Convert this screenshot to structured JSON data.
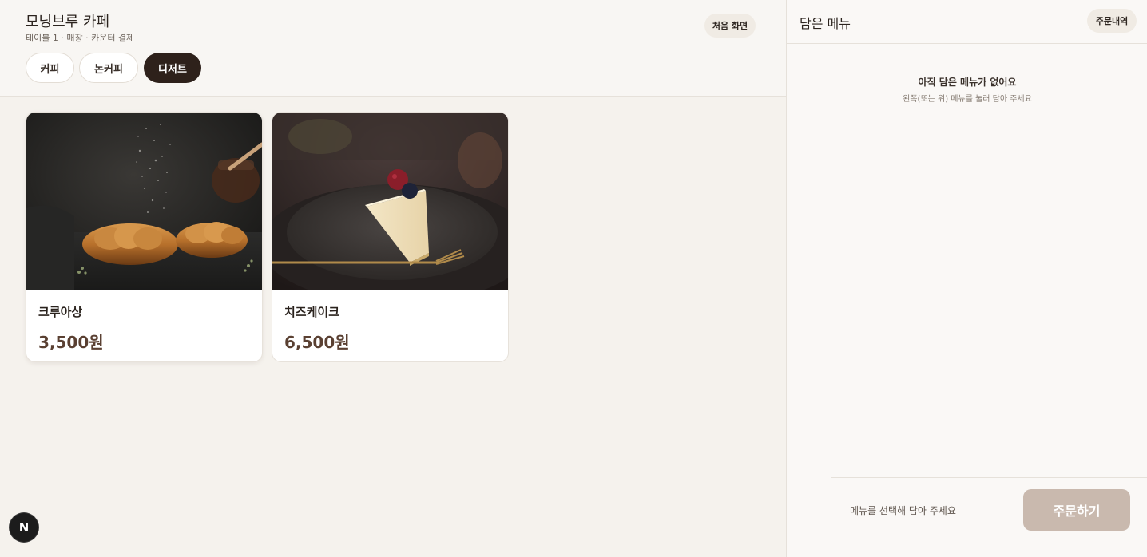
{
  "header": {
    "store_name": "모닝브루 카페",
    "store_info": "테이블 1 · 매장 · 카운터 결제",
    "home_button": "처음 화면"
  },
  "tabs": [
    {
      "label": "커피",
      "active": false
    },
    {
      "label": "논커피",
      "active": false
    },
    {
      "label": "디저트",
      "active": true
    }
  ],
  "menu_items": [
    {
      "name": "크루아상",
      "price": "3,500원",
      "image": "croissant-photo"
    },
    {
      "name": "치즈케이크",
      "price": "6,500원",
      "image": "cheesecake-photo"
    }
  ],
  "cart": {
    "title": "담은 메뉴",
    "history_button": "주문내역",
    "empty_title": "아직 담은 메뉴가 없어요",
    "empty_subtitle": "왼쪽(또는 위) 메뉴를 눌러 담아 주세요",
    "footer_hint": "메뉴를 선택해 담아 주세요",
    "order_button": "주문하기"
  },
  "logo": {
    "letter": "N"
  },
  "colors": {
    "accent_dark": "#2e211b",
    "price": "#5a4032",
    "order_disabled": "#c9b9ae"
  }
}
